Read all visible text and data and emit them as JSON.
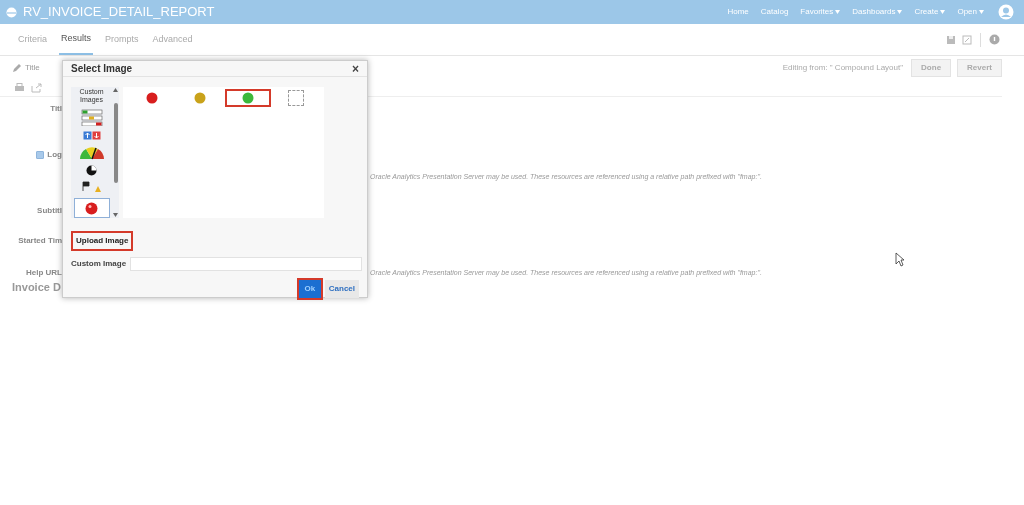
{
  "header": {
    "title": "RV_INVOICE_DETAIL_REPORT",
    "nav": [
      {
        "label": "Home",
        "dropdown": false
      },
      {
        "label": "Catalog",
        "dropdown": false
      },
      {
        "label": "Favorites",
        "dropdown": true
      },
      {
        "label": "Dashboards",
        "dropdown": true
      },
      {
        "label": "Create",
        "dropdown": true
      },
      {
        "label": "Open",
        "dropdown": true
      }
    ]
  },
  "tabs": [
    {
      "label": "Criteria",
      "selected": false
    },
    {
      "label": "Results",
      "selected": true
    },
    {
      "label": "Prompts",
      "selected": false
    },
    {
      "label": "Advanced",
      "selected": false
    }
  ],
  "toolbar": {
    "title_label": "Title",
    "editing_from": "Editing from: \" Compound Layout\"",
    "buttons": [
      "Done",
      "Revert"
    ]
  },
  "form": {
    "labels": [
      {
        "text": "Titl",
        "checkbox": false
      },
      {
        "text": "Log",
        "checkbox": true,
        "checked": true
      },
      {
        "text": "Subtitl",
        "checkbox": false
      },
      {
        "text": "Started Tim",
        "checkbox": false
      },
      {
        "text": "Help URL",
        "checkbox": false
      }
    ],
    "hints": [
      "Oracle Analytics Presentation Server may be used. These resources are referenced using a relative path prefixed with \"fmap:\".",
      "Oracle Analytics Presentation Server may be used. These resources are referenced using a relative path prefixed with \"fmap:\"."
    ],
    "section_title": "Invoice D"
  },
  "dialog": {
    "title": "Select Image",
    "close": "×",
    "categories": [
      {
        "kind": "label",
        "text": "Custom Images",
        "selected": false
      },
      {
        "kind": "bars",
        "selected": false
      },
      {
        "kind": "arrows",
        "selected": false
      },
      {
        "kind": "gauge",
        "selected": false
      },
      {
        "kind": "pie",
        "selected": false
      },
      {
        "kind": "flags",
        "selected": false
      },
      {
        "kind": "ball",
        "selected": true
      }
    ],
    "images": [
      {
        "kind": "ball",
        "color": "#d81e1e",
        "selected": false
      },
      {
        "kind": "ball",
        "color": "#c9a21a",
        "selected": false
      },
      {
        "kind": "ball",
        "color": "#3cb83c",
        "selected": true
      },
      {
        "kind": "empty",
        "selected": false
      }
    ],
    "upload_button": {
      "label": "Upload Image",
      "highlighted": true
    },
    "custom_image": {
      "label": "Custom Image"
    },
    "ok_button": {
      "label": "Ok",
      "highlighted": true
    },
    "cancel_button": {
      "label": "Cancel"
    }
  }
}
